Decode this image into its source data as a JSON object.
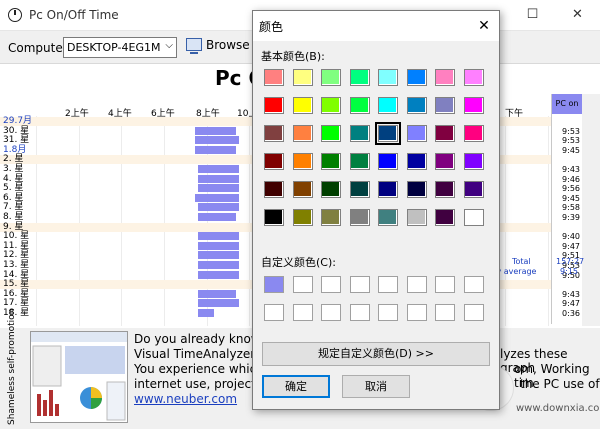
{
  "window": {
    "title": "Pc On/Off Time",
    "minimize_glyph": "—",
    "maximize_glyph": "☐",
    "close_glyph": "✕"
  },
  "toolbar": {
    "computer_label": "Computer",
    "computer_value": "DESKTOP-4EG1M",
    "browse_label": "Browse"
  },
  "chart": {
    "title": "Pc O",
    "hour_labels": [
      "2上午",
      "4上午",
      "6上午",
      "8上午",
      "10上",
      "下午"
    ],
    "pc_on_header": "PC on",
    "total_label": "Total",
    "total_value": "157:27",
    "daily_average_label": "ily average",
    "daily_average_value": "9:15",
    "colors": {
      "bar": "#8a89f0",
      "weekend_band": "#fdf3e4",
      "month_label": "#1b3fbf"
    },
    "rows": [
      {
        "label": "29.7月",
        "month": true,
        "time": "",
        "bar": null
      },
      {
        "label": "30. 星",
        "month": false,
        "time": "9:53",
        "bar": [
          0.5,
          0.63
        ]
      },
      {
        "label": "31. 星",
        "month": false,
        "time": "9:53",
        "bar": [
          0.5,
          0.64
        ]
      },
      {
        "label": "1.8月",
        "month": true,
        "time": "9:45",
        "bar": [
          0.5,
          0.63
        ]
      },
      {
        "label": "2. 星",
        "month": false,
        "time": "",
        "bar": null
      },
      {
        "label": "3. 星",
        "month": false,
        "time": "9:43",
        "bar": [
          0.51,
          0.64
        ]
      },
      {
        "label": "4. 星",
        "month": false,
        "time": "9:46",
        "bar": [
          0.51,
          0.64
        ]
      },
      {
        "label": "5. 星",
        "month": false,
        "time": "9:56",
        "bar": [
          0.51,
          0.64
        ]
      },
      {
        "label": "6. 星",
        "month": false,
        "time": "9:45",
        "bar": [
          0.5,
          0.64
        ]
      },
      {
        "label": "7. 星",
        "month": false,
        "time": "9:58",
        "bar": [
          0.51,
          0.64
        ]
      },
      {
        "label": "8. 星",
        "month": false,
        "time": "9:39",
        "bar": [
          0.51,
          0.63
        ]
      },
      {
        "label": "9. 星",
        "month": false,
        "time": "",
        "bar": null
      },
      {
        "label": "10. 星",
        "month": false,
        "time": "9:40",
        "bar": [
          0.51,
          0.64
        ]
      },
      {
        "label": "11. 星",
        "month": false,
        "time": "9:47",
        "bar": [
          0.51,
          0.64
        ]
      },
      {
        "label": "12. 星",
        "month": false,
        "time": "9:51",
        "bar": [
          0.51,
          0.64
        ]
      },
      {
        "label": "13. 星",
        "month": false,
        "time": "9:53",
        "bar": [
          0.51,
          0.64
        ]
      },
      {
        "label": "14. 星",
        "month": false,
        "time": "9:50",
        "bar": [
          0.51,
          0.64
        ]
      },
      {
        "label": "15. 星",
        "month": false,
        "time": "",
        "bar": null
      },
      {
        "label": "16. 星",
        "month": false,
        "time": "9:43",
        "bar": [
          0.51,
          0.63
        ]
      },
      {
        "label": "17. 星",
        "month": false,
        "time": "9:47",
        "bar": [
          0.51,
          0.64
        ]
      },
      {
        "label": "18. 星",
        "month": false,
        "time": "0:36",
        "bar": [
          0.51,
          0.56
        ]
      }
    ]
  },
  "promo": {
    "vertical_label": "Shameless self-promotion",
    "line1": "Do you already know o",
    "line2": "Visual TimeAnalyzer tra",
    "line2_right": "lyzes these graph",
    "line3": "You experience which",
    "line3_right": "om, Working tim",
    "line4": "internet use, projects a",
    "line4_right": "the PC use of",
    "link": "www.neuber.com"
  },
  "watermark": {
    "text": "www.downxia.com"
  },
  "color_dialog": {
    "title": "颜色",
    "close_glyph": "✕",
    "basic_label": "基本颜色(B):",
    "custom_label": "自定义颜色(C):",
    "define_custom_label": "规定自定义颜色(D) >>",
    "ok_label": "确定",
    "cancel_label": "取消",
    "selected_index": 20,
    "basic_colors": [
      "#ff8080",
      "#ffff80",
      "#80ff80",
      "#00ff80",
      "#80ffff",
      "#0080ff",
      "#ff80c0",
      "#ff80ff",
      "#ff0000",
      "#ffff00",
      "#80ff00",
      "#00ff40",
      "#00ffff",
      "#0080c0",
      "#8080c0",
      "#ff00ff",
      "#804040",
      "#ff8040",
      "#00ff00",
      "#008080",
      "#004080",
      "#8080ff",
      "#800040",
      "#ff0080",
      "#800000",
      "#ff8000",
      "#008000",
      "#008040",
      "#0000ff",
      "#0000a0",
      "#800080",
      "#8000ff",
      "#400000",
      "#804000",
      "#004000",
      "#004040",
      "#000080",
      "#000040",
      "#400040",
      "#400080",
      "#000000",
      "#808000",
      "#808040",
      "#808080",
      "#408080",
      "#c0c0c0",
      "#400040",
      "#ffffff"
    ],
    "custom_colors": [
      "#8a89f0",
      "#ffffff",
      "#ffffff",
      "#ffffff",
      "#ffffff",
      "#ffffff",
      "#ffffff",
      "#ffffff",
      "#ffffff",
      "#ffffff",
      "#ffffff",
      "#ffffff",
      "#ffffff",
      "#ffffff",
      "#ffffff",
      "#ffffff"
    ]
  }
}
